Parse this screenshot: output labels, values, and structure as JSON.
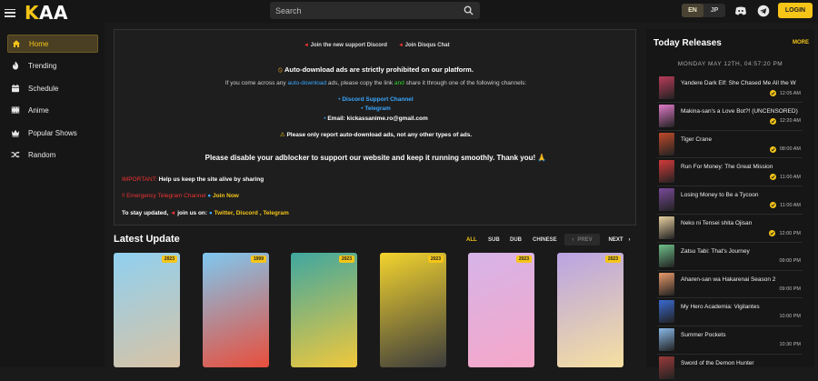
{
  "header": {
    "logo_k": "K",
    "logo_rest": "AA",
    "search_placeholder": "Search",
    "lang_active": "EN",
    "lang_other": "JP",
    "login_label": "LOGIN"
  },
  "sidebar": {
    "items": [
      {
        "label": "Home",
        "icon": "home-icon",
        "active": true
      },
      {
        "label": "Trending",
        "icon": "fire-icon"
      },
      {
        "label": "Schedule",
        "icon": "calendar-icon"
      },
      {
        "label": "Anime",
        "icon": "film-icon"
      },
      {
        "label": "Popular Shows",
        "icon": "crown-icon"
      },
      {
        "label": "Random",
        "icon": "shuffle-icon"
      }
    ]
  },
  "notice": {
    "pill_discord": "Join the new support Discord",
    "pill_disqus": "Join Disqus Chat",
    "warning_title": "Auto-download ads are strictly prohibited on our platform.",
    "line1_a": "If you come across any ",
    "line1_b": "auto-download",
    "line1_c": " ads, please copy the link ",
    "line1_d": "and",
    "line1_e": " share it through one of the following channels:",
    "ch_discord": "Discord Support Channel",
    "ch_telegram": "Telegram",
    "ch_email": "Email: kickassanime.ro@gmail.com",
    "report_note": "Please only report auto-download ads, not any other types of ads.",
    "adblock": "Please disable your adblocker to support our website and keep it running smoothly. Thank you! 🙏",
    "important_label": "IMPORTANT:",
    "important_text": " Help us keep the site alive by sharing",
    "emergency_label": "Emergency Telegram Channel",
    "join_now": "Join Now",
    "stay_a": "To stay updated, ",
    "stay_b": " join us on: ",
    "stay_links": "Twitter, Discord , Telegram"
  },
  "latest": {
    "title": "Latest Update",
    "filters": [
      "ALL",
      "SUB",
      "DUB",
      "CHINESE"
    ],
    "prev": "PREV",
    "next": "NEXT",
    "cards": [
      {
        "year": "2023",
        "color1": "#8fd0f0",
        "color2": "#d8c3a5"
      },
      {
        "year": "1999",
        "color1": "#7ec8f0",
        "color2": "#e94e3b"
      },
      {
        "year": "2023",
        "color1": "#3fa7a0",
        "color2": "#f0c83c"
      },
      {
        "year": "2023",
        "color1": "#f2d32e",
        "color2": "#3c3c3c"
      },
      {
        "year": "2023",
        "color1": "#d6b4e8",
        "color2": "#f6a7c8"
      },
      {
        "year": "2023",
        "color1": "#b9a3e3",
        "color2": "#f6e0a0"
      }
    ]
  },
  "today": {
    "title": "Today Releases",
    "more": "MORE",
    "date": "MONDAY MAY 12TH, 04:57:20 PM",
    "items": [
      {
        "name": "Yandere Dark Elf: She Chased Me All the W",
        "time": "12:05 AM",
        "done": true,
        "color": "#b83c5a"
      },
      {
        "name": "Makina-san's a Love Bot?! (UNCENSORED)",
        "time": "12:20 AM",
        "done": true,
        "color": "#e07ac8"
      },
      {
        "name": "Tiger Crane",
        "time": "08:00 AM",
        "done": true,
        "color": "#c04a2a"
      },
      {
        "name": "Run For Money: The Great Mission",
        "time": "11:00 AM",
        "done": true,
        "color": "#d43a3a"
      },
      {
        "name": "Losing Money to Be a Tycoon",
        "time": "11:00 AM",
        "done": true,
        "color": "#7a4a9a"
      },
      {
        "name": "Neko ni Tensei shita Ojisan",
        "time": "12:00 PM",
        "done": true,
        "color": "#e8d0a0"
      },
      {
        "name": "Zatsu Tabi: That's Journey",
        "time": "09:00 PM",
        "done": false,
        "color": "#6fbf8a"
      },
      {
        "name": "Aharen-san wa Hakarenai Season 2",
        "time": "09:00 PM",
        "done": false,
        "color": "#e89a6a"
      },
      {
        "name": "My Hero Academia: Vigilantes",
        "time": "10:00 PM",
        "done": false,
        "color": "#3a6ad0"
      },
      {
        "name": "Summer Pockets",
        "time": "10:30 PM",
        "done": false,
        "color": "#8ab8e8"
      },
      {
        "name": "Sword of the Demon Hunter",
        "time": "",
        "done": false,
        "color": "#9a3a3a"
      }
    ]
  }
}
